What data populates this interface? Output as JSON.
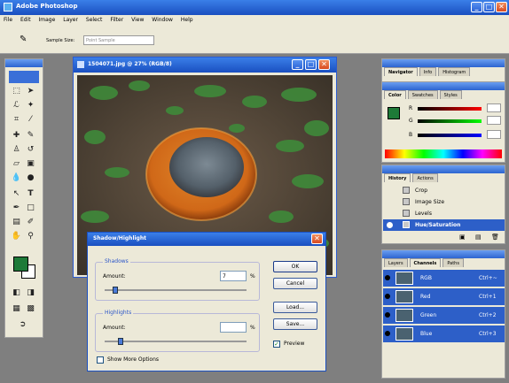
{
  "app": {
    "title": "Adobe Photoshop"
  },
  "menubar": [
    "File",
    "Edit",
    "Image",
    "Layer",
    "Select",
    "Filter",
    "View",
    "Window",
    "Help"
  ],
  "options_bar": {
    "sample_label": "Sample Size:",
    "sample_value": "Point Sample"
  },
  "document": {
    "title": "1504071.jpg @ 27% (RGB/8)"
  },
  "dialog": {
    "title": "Shadow/Highlight",
    "shadows_label": "Shadows",
    "shadows_amount_label": "Amount:",
    "shadows_amount": "7",
    "highlights_label": "Highlights",
    "highlights_amount_label": "Amount:",
    "highlights_amount": "0",
    "percent": "%",
    "ok": "OK",
    "cancel": "Cancel",
    "load": "Load...",
    "save": "Save...",
    "preview": "Preview",
    "more_options": "Show More Options"
  },
  "navigator_panel": {
    "tabs": [
      "Navigator",
      "Info",
      "Histogram"
    ]
  },
  "color_panel": {
    "tabs": [
      "Color",
      "Swatches",
      "Styles"
    ],
    "labels": [
      "R",
      "G",
      "B"
    ]
  },
  "history_panel": {
    "tabs": [
      "History",
      "Actions"
    ],
    "items": [
      "Crop",
      "Image Size",
      "Levels",
      "Hue/Saturation"
    ]
  },
  "channels_panel": {
    "tabs": [
      "Layers",
      "Channels",
      "Paths"
    ],
    "rows": [
      {
        "name": "RGB",
        "shortcut": "Ctrl+~"
      },
      {
        "name": "Red",
        "shortcut": "Ctrl+1"
      },
      {
        "name": "Green",
        "shortcut": "Ctrl+2"
      },
      {
        "name": "Blue",
        "shortcut": "Ctrl+3"
      }
    ]
  },
  "colors": {
    "titlebar": "#1a4fc0",
    "foreground_swatch": "#1e7a38",
    "selection": "#2d5fc8"
  }
}
